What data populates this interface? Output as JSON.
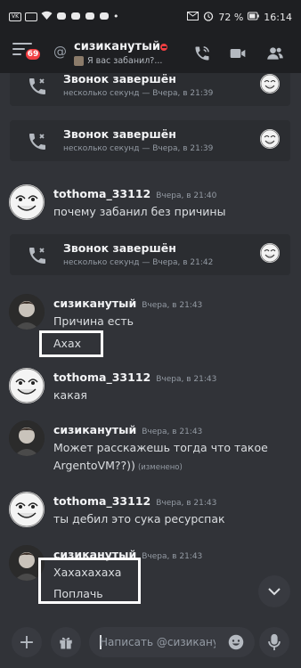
{
  "status_bar": {
    "time": "16:14",
    "battery": "72 %",
    "vkontakte_label": "VK"
  },
  "header": {
    "unread_badge": "69",
    "channel_name": "сизиканутый",
    "channel_status": "Я вас забанил?..."
  },
  "messages": [
    {
      "type": "call",
      "title": "Звонок завершён",
      "subtitle": "несколько секунд — Вчера, в 21:39"
    },
    {
      "type": "call",
      "title": "Звонок завершён",
      "subtitle": "несколько секунд — Вчера, в 21:39"
    },
    {
      "type": "message",
      "author": "tothoma_33112",
      "time": "Вчера, в 21:40",
      "lines": [
        "почему забанил без причины"
      ]
    },
    {
      "type": "call",
      "title": "Звонок завершён",
      "subtitle": "несколько секунд — Вчера, в 21:42"
    },
    {
      "type": "message",
      "author": "сизиканутый",
      "time": "Вчера, в 21:43",
      "lines": [
        "Причина есть",
        "Ахах"
      ]
    },
    {
      "type": "message",
      "author": "tothoma_33112",
      "time": "Вчера, в 21:43",
      "lines": [
        "какая"
      ]
    },
    {
      "type": "message",
      "author": "сизиканутый",
      "time": "Вчера, в 21:43",
      "lines": [
        "Может расскажешь тогда что такое",
        "ArgentoVM??))"
      ],
      "edited": "(изменено)"
    },
    {
      "type": "message",
      "author": "tothoma_33112",
      "time": "Вчера, в 21:43",
      "lines": [
        "ты дебил это сука ресурспак"
      ]
    },
    {
      "type": "message",
      "author": "сизиканутый",
      "time": "Вчера, в 21:43",
      "lines": [
        "Хахахахаха",
        "Поплачь"
      ]
    }
  ],
  "composer": {
    "placeholder": "Написать @сизиканутый",
    "add_label": "+"
  },
  "colors": {
    "background": "#313338",
    "header": "#1e1f22",
    "card": "#2b2d31",
    "dnd": "#f23f42",
    "badge": "#f23f42"
  }
}
